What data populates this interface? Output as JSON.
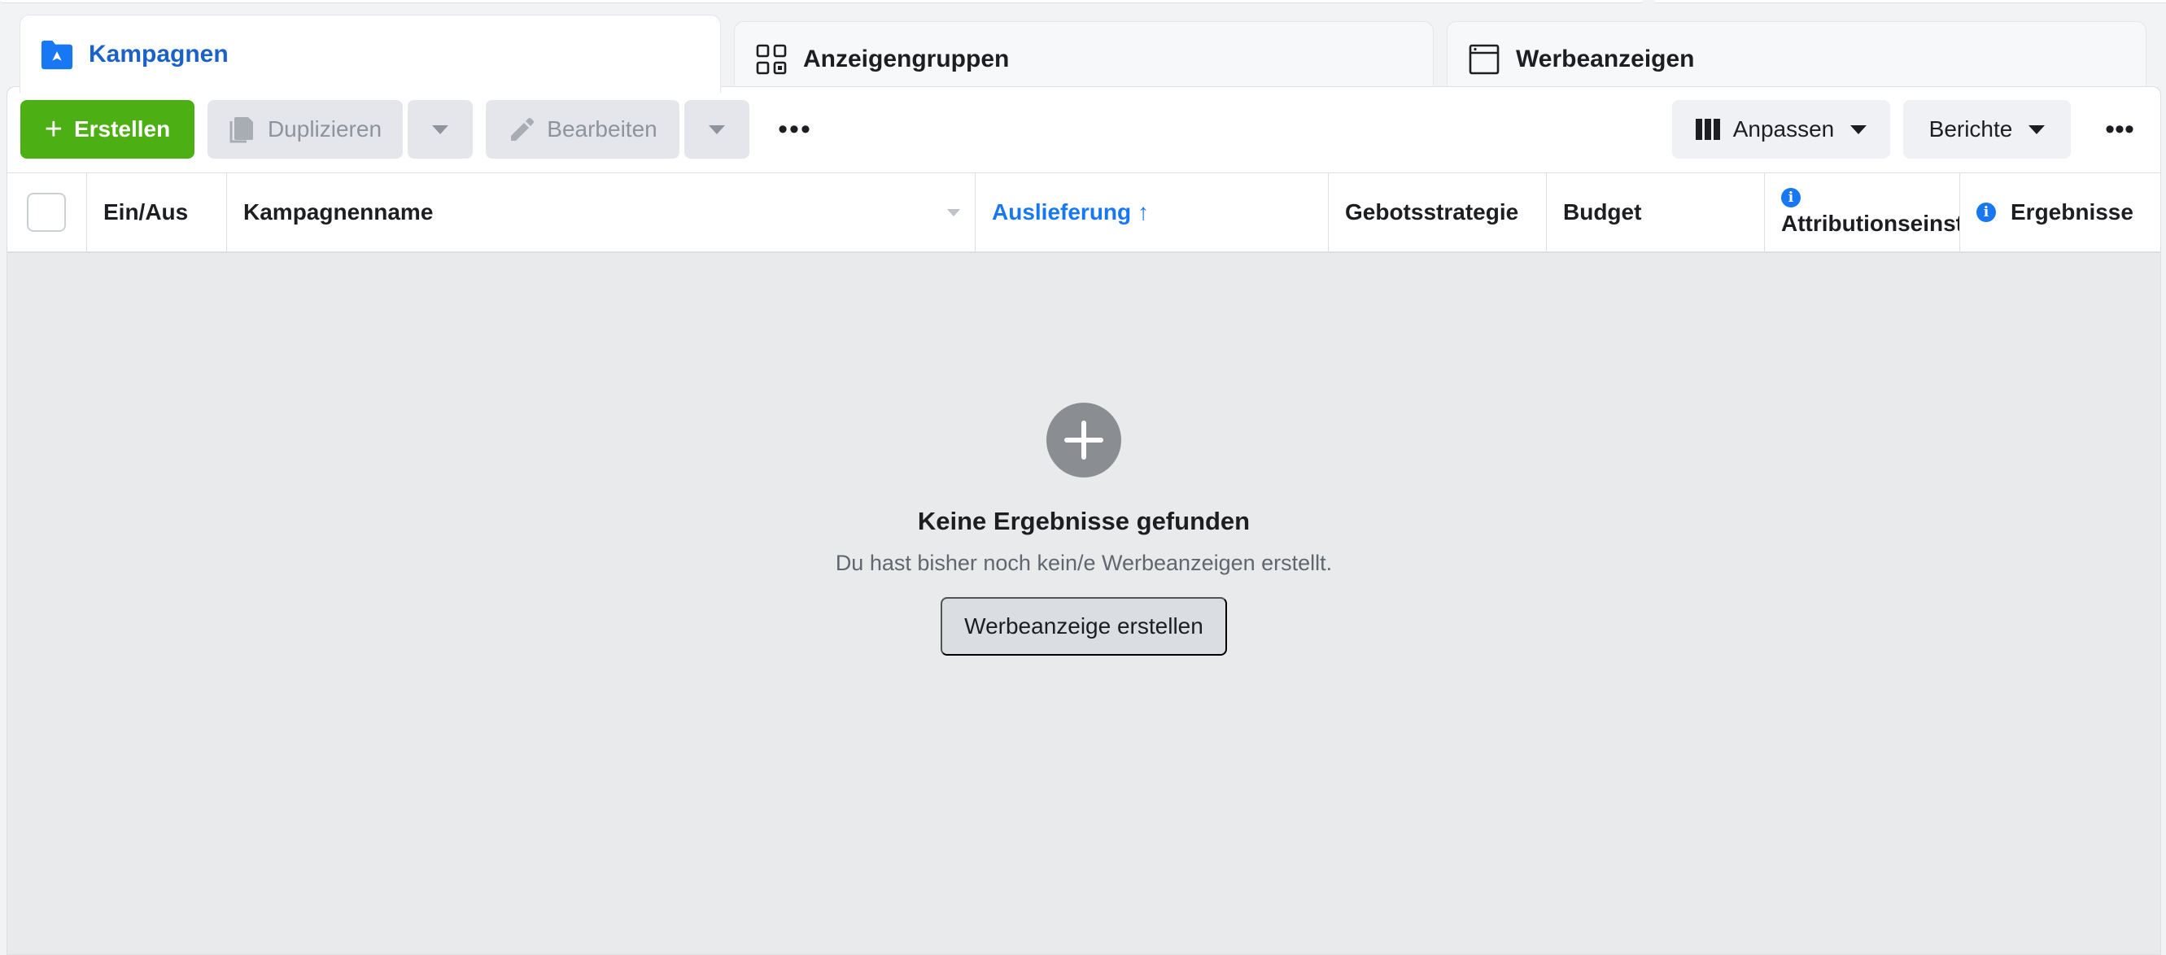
{
  "tabs": [
    {
      "label": "Kampagnen",
      "icon": "folder-flag-icon",
      "active": true
    },
    {
      "label": "Anzeigengruppen",
      "icon": "grid-icon",
      "active": false
    },
    {
      "label": "Werbeanzeigen",
      "icon": "window-icon",
      "active": false
    }
  ],
  "toolbar": {
    "create_label": "Erstellen",
    "duplicate_label": "Duplizieren",
    "edit_label": "Bearbeiten",
    "more_label": "•••",
    "customize_label": "Anpassen",
    "reports_label": "Berichte",
    "more_right_label": "•••"
  },
  "table": {
    "columns": [
      {
        "label": "Ein/Aus"
      },
      {
        "label": "Kampagnenname"
      },
      {
        "label": "Auslieferung",
        "sort": "↑"
      },
      {
        "label": "Gebotsstrategie"
      },
      {
        "label": "Budget"
      },
      {
        "label": "Attributionseinst"
      },
      {
        "label": "Ergebnisse"
      }
    ]
  },
  "empty_state": {
    "title": "Keine Ergebnisse gefunden",
    "subtitle": "Du hast bisher noch kein/e Werbeanzeigen erstellt.",
    "button_label": "Werbeanzeige erstellen"
  },
  "colors": {
    "accent": "#1877f2",
    "create_green": "#4caf14",
    "background": "#e9eaec"
  }
}
